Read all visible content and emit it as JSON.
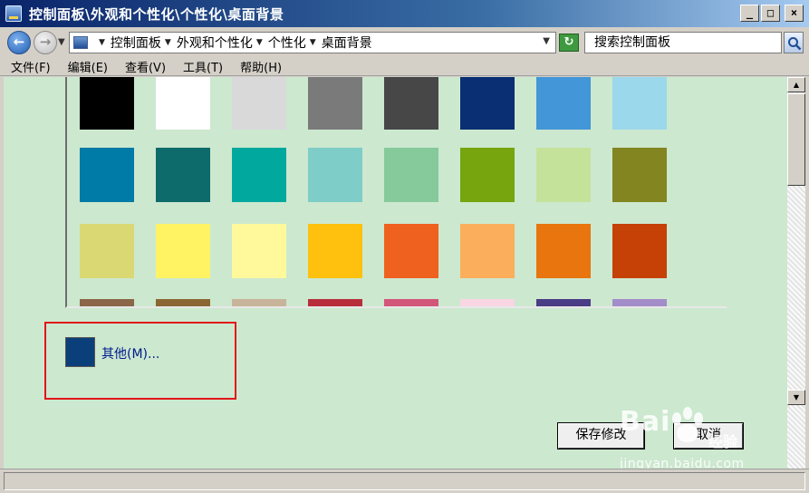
{
  "window": {
    "title": "控制面板\\外观和个性化\\个性化\\桌面背景",
    "minimize": "_",
    "maximize": "□",
    "close": "×"
  },
  "address": {
    "breadcrumbs": [
      "控制面板",
      "外观和个性化",
      "个性化",
      "桌面背景"
    ],
    "search_placeholder": "搜索控制面板",
    "back_icon": "back-arrow-icon",
    "forward_icon": "forward-arrow-icon",
    "refresh_icon": "refresh-icon"
  },
  "menu": [
    "文件(F)",
    "编辑(E)",
    "查看(V)",
    "工具(T)",
    "帮助(H)"
  ],
  "palette": {
    "rows": [
      [
        "#000000",
        "#ffffff",
        "#d9d9d9",
        "#7a7a7a",
        "#474747",
        "#0a2f72",
        "#4396d7",
        "#9cd8ec"
      ],
      [
        "#007aa6",
        "#0e6b6b",
        "#00a89d",
        "#7ecdc8",
        "#86c99a",
        "#76a50d",
        "#c5e29b",
        "#838520"
      ],
      [
        "#d9d873",
        "#fff364",
        "#fff99c",
        "#ffc10e",
        "#ef611f",
        "#fbae5c",
        "#e8750d",
        "#c54106"
      ],
      [
        "#8b6648",
        "#8b6633",
        "#c8b49a",
        "#b72d3c",
        "#d25679",
        "#f9d6e4",
        "#4a3c85",
        "#a28dc8"
      ]
    ]
  },
  "other_color": {
    "label": "其他(M)...",
    "swatch": "#0b3f7a"
  },
  "buttons": {
    "save": "保存修改",
    "cancel": "取消"
  },
  "watermark": {
    "brand": "Bai",
    "brand_suffix": "经验",
    "url": "jingyan.baidu.com"
  }
}
